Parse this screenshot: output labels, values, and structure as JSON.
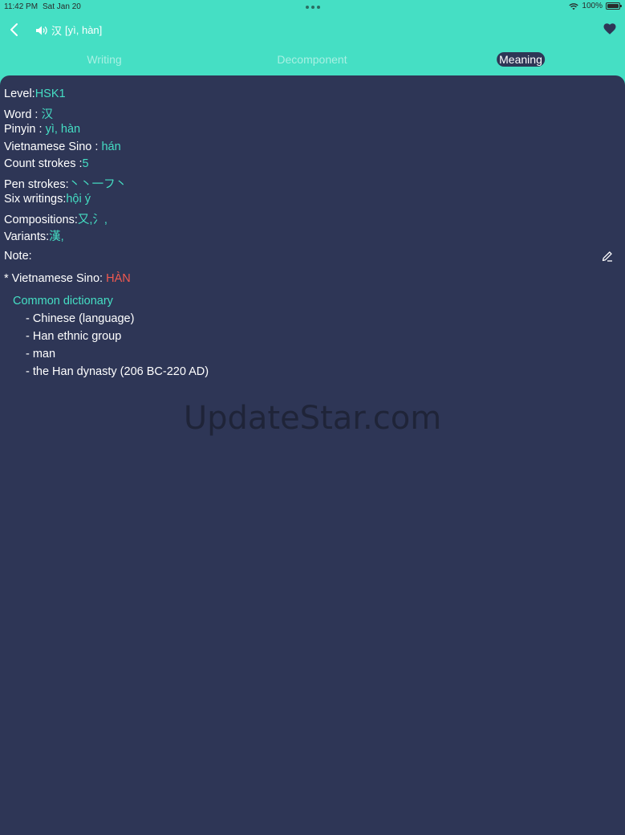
{
  "status_bar": {
    "time": "11:42 PM",
    "date": "Sat Jan 20",
    "battery": "100%"
  },
  "header": {
    "word": "汉",
    "pinyin": "[yì, hàn]"
  },
  "tabs": [
    {
      "label": "Writing"
    },
    {
      "label": "Decomponent"
    },
    {
      "label": "Meaning",
      "active": true
    }
  ],
  "details": {
    "level_label": "Level:",
    "level_value": "HSK1",
    "word_label": "Word : ",
    "word_value": "汉",
    "pinyin_label": "Pinyin : ",
    "pinyin_value": "yì, hàn",
    "sino_label": "Vietnamese Sino : ",
    "sino_value": "hán",
    "count_label": "Count strokes :",
    "count_value": "5",
    "pen_label": "Pen strokes:",
    "pen_value": "丶丶一フ丶",
    "six_label": "Six writings:",
    "six_value": "hội ý",
    "comp_label": "Compositions:",
    "comp_value": "又,氵,",
    "var_label": "Variants:",
    "var_value": "漢,"
  },
  "note": {
    "label": "Note:"
  },
  "sino_line": {
    "label": "* Vietnamese Sino: ",
    "value": "HÀN"
  },
  "dictionary": {
    "heading": "Common dictionary",
    "items": [
      "- Chinese (language)",
      "- Han ethnic group",
      "- man",
      "- the Han dynasty (206 BC-220 AD)"
    ]
  },
  "watermark": "UpdateStar.com",
  "colors": {
    "header_bg": "#45DFC4",
    "content_bg": "#2E3656",
    "accent": "#45DFC4",
    "highlight": "#F2594F"
  },
  "icons": [
    "back-chevron-icon",
    "speaker-icon",
    "heart-icon",
    "edit-pencil-icon",
    "wifi-icon",
    "battery-icon"
  ]
}
